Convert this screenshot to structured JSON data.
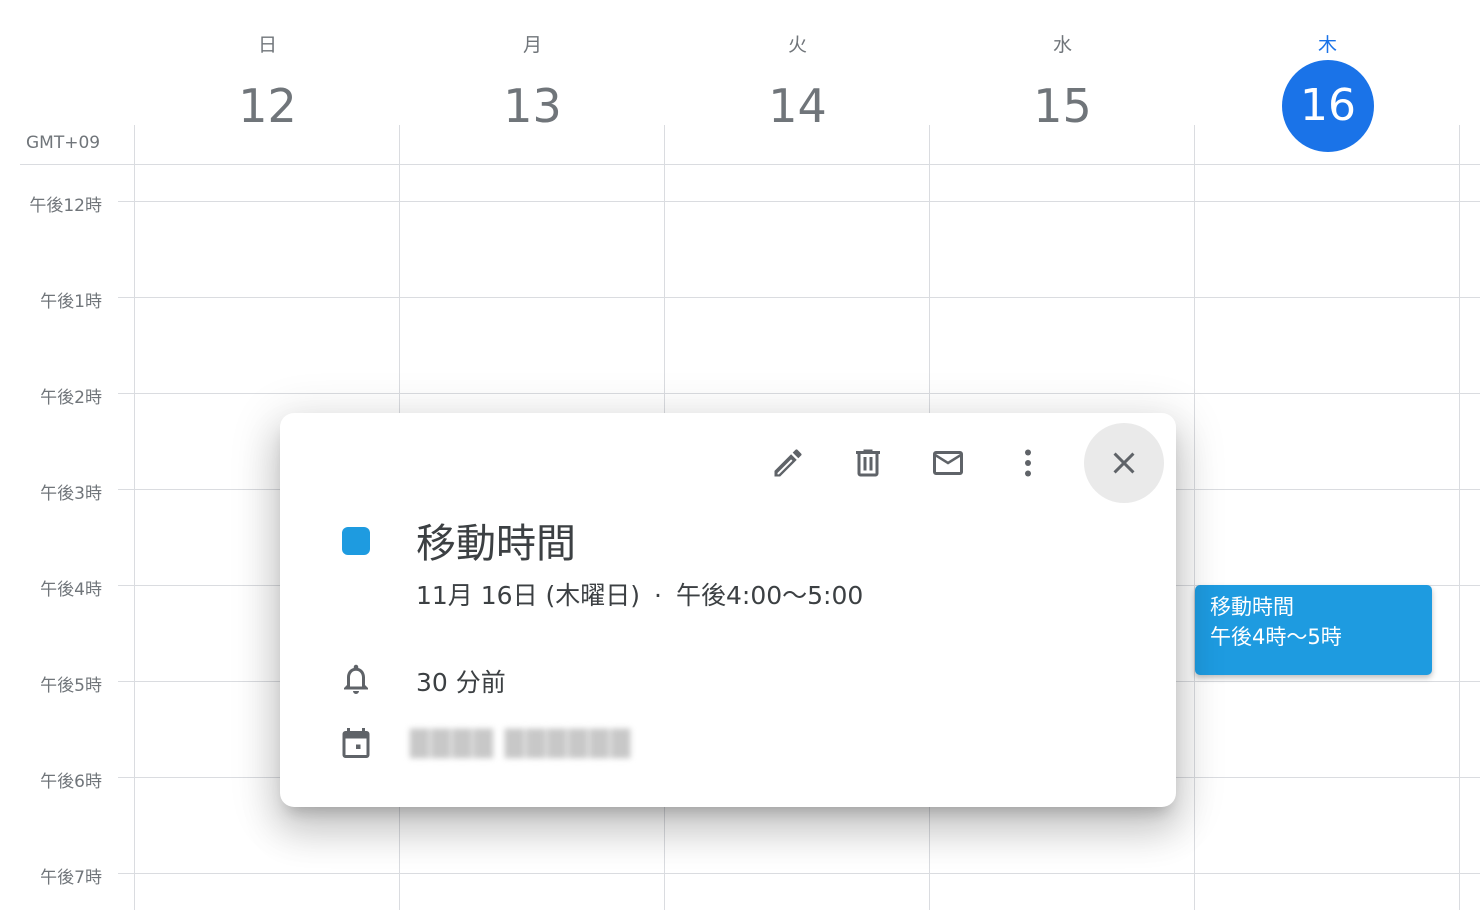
{
  "timezone": "GMT+09",
  "days": [
    {
      "dow": "日",
      "num": "12"
    },
    {
      "dow": "月",
      "num": "13"
    },
    {
      "dow": "火",
      "num": "14"
    },
    {
      "dow": "水",
      "num": "15"
    },
    {
      "dow": "木",
      "num": "16"
    }
  ],
  "hours": [
    "午後12時",
    "午後1時",
    "午後2時",
    "午後3時",
    "午後4時",
    "午後5時",
    "午後6時",
    "午後7時"
  ],
  "event_chip": {
    "title": "移動時間",
    "time": "午後4時〜5時",
    "color": "#1e9be0"
  },
  "popup": {
    "title": "移動時間",
    "date": "11月 16日 (木曜日)",
    "separator": "·",
    "time_range": "午後4:00〜5:00",
    "reminder": "30 分前",
    "calendar_name": "████ ██████",
    "color": "#1e9be0",
    "tools": [
      "pencil-icon",
      "trash-icon",
      "mail-icon",
      "more-vert-icon",
      "close-icon"
    ]
  },
  "colors": {
    "today": "#1a73e8",
    "grid": "#dadce0",
    "muted_text": "#70757a"
  }
}
